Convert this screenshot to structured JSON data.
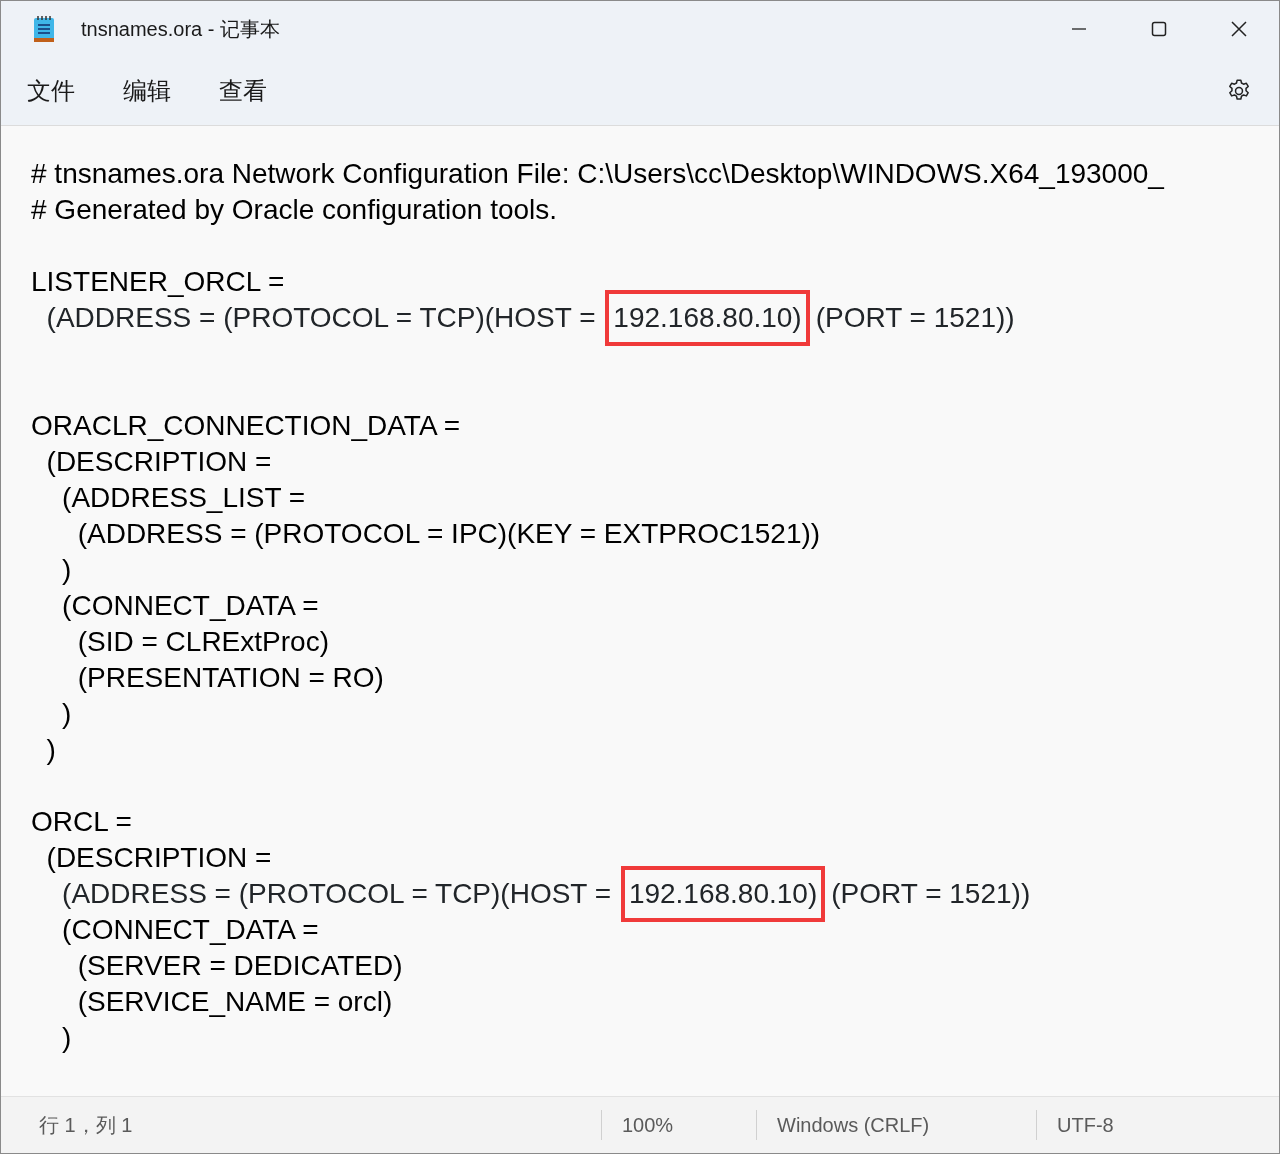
{
  "window": {
    "title": "tnsnames.ora - 记事本"
  },
  "menu": [
    "文件",
    "编辑",
    "查看"
  ],
  "editor": {
    "lines": [
      {
        "kind": "text",
        "text": "# tnsnames.ora Network Configuration File: C:\\Users\\cc\\Desktop\\WINDOWS.X64_193000_"
      },
      {
        "kind": "text",
        "text": "# Generated by Oracle configuration tools."
      },
      {
        "kind": "blank"
      },
      {
        "kind": "text",
        "text": "LISTENER_ORCL ="
      },
      {
        "kind": "marked",
        "segments": [
          {
            "text": "  (ADDRESS = (PROTOCOL = TCP)(HOST = ",
            "boxed": false
          },
          {
            "text": "192.168.80.10)",
            "boxed": true
          },
          {
            "text": "(PORT = 1521))",
            "boxed": false
          }
        ]
      },
      {
        "kind": "blank"
      },
      {
        "kind": "blank"
      },
      {
        "kind": "text",
        "text": "ORACLR_CONNECTION_DATA ="
      },
      {
        "kind": "text",
        "text": "  (DESCRIPTION ="
      },
      {
        "kind": "text",
        "text": "    (ADDRESS_LIST ="
      },
      {
        "kind": "text",
        "text": "      (ADDRESS = (PROTOCOL = IPC)(KEY = EXTPROC1521))"
      },
      {
        "kind": "text",
        "text": "    )"
      },
      {
        "kind": "text",
        "text": "    (CONNECT_DATA ="
      },
      {
        "kind": "text",
        "text": "      (SID = CLRExtProc)"
      },
      {
        "kind": "text",
        "text": "      (PRESENTATION = RO)"
      },
      {
        "kind": "text",
        "text": "    )"
      },
      {
        "kind": "text",
        "text": "  )"
      },
      {
        "kind": "blank"
      },
      {
        "kind": "text",
        "text": "ORCL ="
      },
      {
        "kind": "text",
        "text": "  (DESCRIPTION ="
      },
      {
        "kind": "marked",
        "segments": [
          {
            "text": "    (ADDRESS = (PROTOCOL = TCP)(HOST = ",
            "boxed": false
          },
          {
            "text": "192.168.80.10)",
            "boxed": true
          },
          {
            "text": "(PORT = 1521))",
            "boxed": false
          }
        ]
      },
      {
        "kind": "text",
        "text": "    (CONNECT_DATA ="
      },
      {
        "kind": "text",
        "text": "      (SERVER = DEDICATED)"
      },
      {
        "kind": "text",
        "text": "      (SERVICE_NAME = orcl)"
      },
      {
        "kind": "text",
        "text": "    )"
      }
    ]
  },
  "status_bar": [
    "行 1，列 1",
    "100%",
    "Windows (CRLF)",
    "UTF-8"
  ]
}
